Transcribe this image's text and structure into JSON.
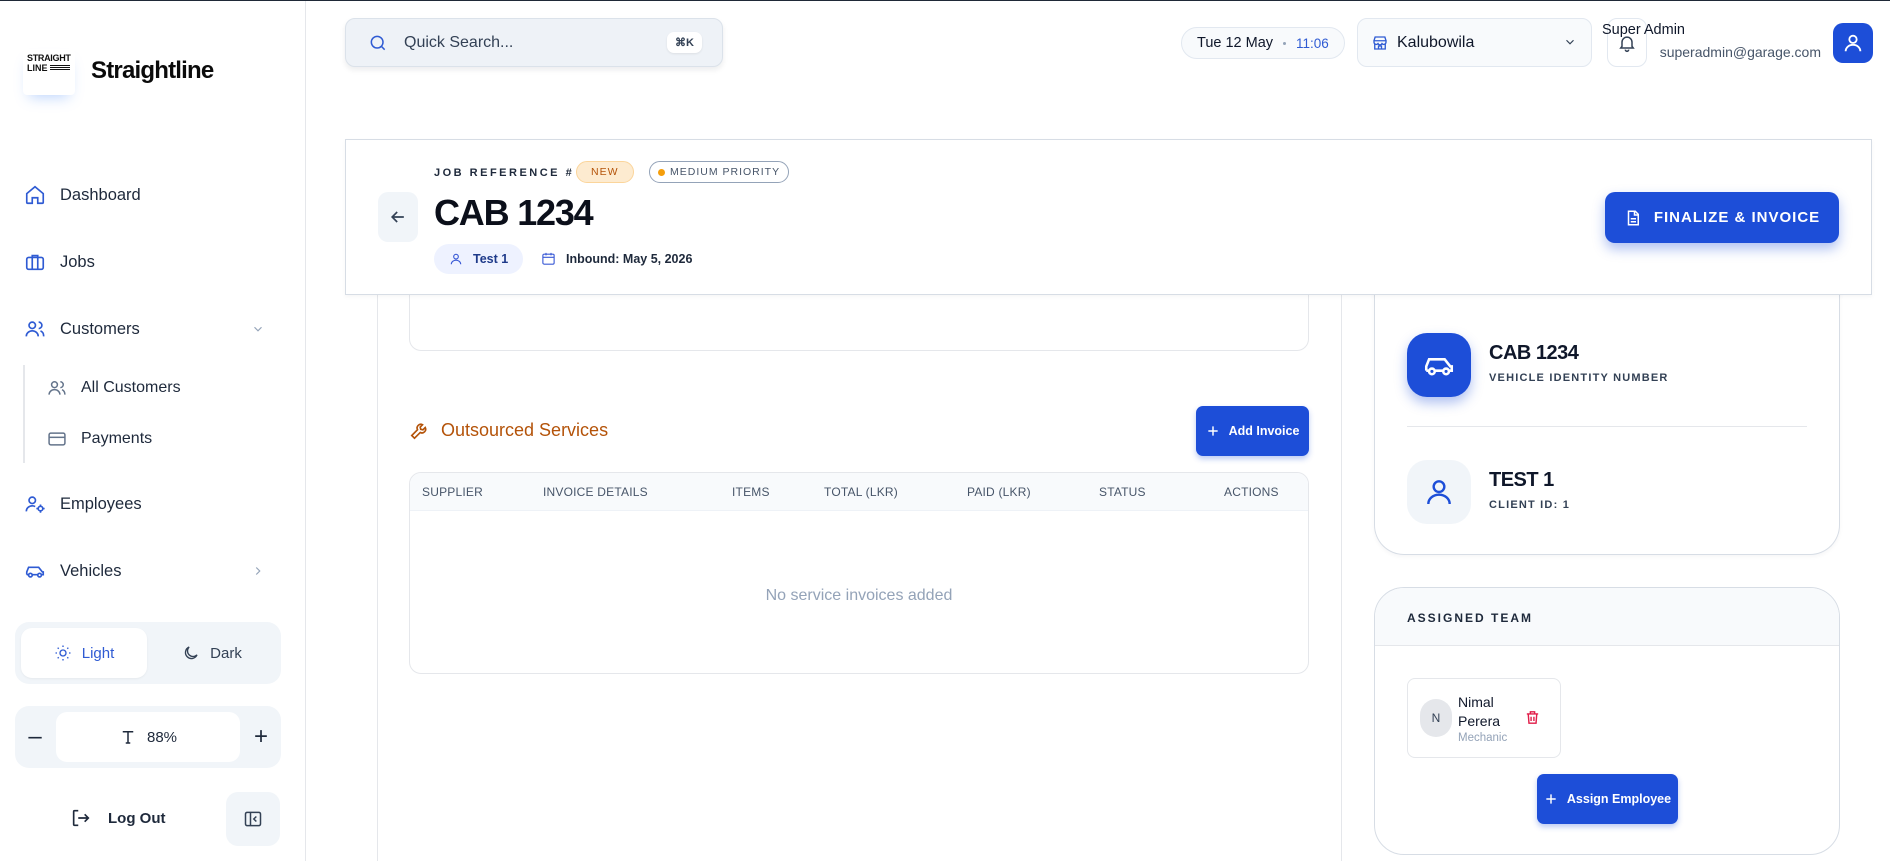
{
  "sidebar": {
    "logo": {
      "line1": "STRAIGHT",
      "line2": "LINE"
    },
    "brand": "Straightline",
    "nav": {
      "dashboard": "Dashboard",
      "jobs": "Jobs",
      "customers": "Customers",
      "all_customers": "All Customers",
      "payments": "Payments",
      "employees": "Employees",
      "vehicles": "Vehicles"
    },
    "theme": {
      "light": "Light",
      "dark": "Dark",
      "selected": "Light"
    },
    "zoom": {
      "minus": "–",
      "value": "88%",
      "plus": "+"
    },
    "logout": "Log Out"
  },
  "topbar": {
    "search_placeholder": "Quick Search...",
    "search_shortcut": "⌘K",
    "date": "Tue 12 May",
    "time": "11:06",
    "branch": "Kalubowila",
    "user_name": "Super Admin",
    "user_email": "superadmin@garage.com"
  },
  "job": {
    "reference_label": "JOB REFERENCE #",
    "status_badge": "NEW",
    "priority_badge": "MEDIUM PRIORITY",
    "title": "CAB 1234",
    "customer": "Test 1",
    "inbound": "Inbound: May 5, 2026",
    "finalize_label": "FINALIZE & INVOICE"
  },
  "outsourced": {
    "title": "Outsourced Services",
    "add_label": "Add Invoice",
    "columns": [
      "SUPPLIER",
      "INVOICE DETAILS",
      "ITEMS",
      "TOTAL (LKR)",
      "PAID (LKR)",
      "STATUS",
      "ACTIONS"
    ],
    "empty": "No service invoices added"
  },
  "vehicle": {
    "plate": "CAB 1234",
    "plate_label": "VEHICLE IDENTITY NUMBER",
    "client": "TEST 1",
    "client_id": "CLIENT ID: 1"
  },
  "team": {
    "title": "ASSIGNED TEAM",
    "members": [
      {
        "initial": "N",
        "name": "Nimal Perera",
        "role": "Mechanic"
      }
    ],
    "assign_label": "Assign Employee"
  },
  "colors": {
    "accent": "#1d4ed8",
    "warning": "#b45309",
    "danger": "#e11d48"
  }
}
